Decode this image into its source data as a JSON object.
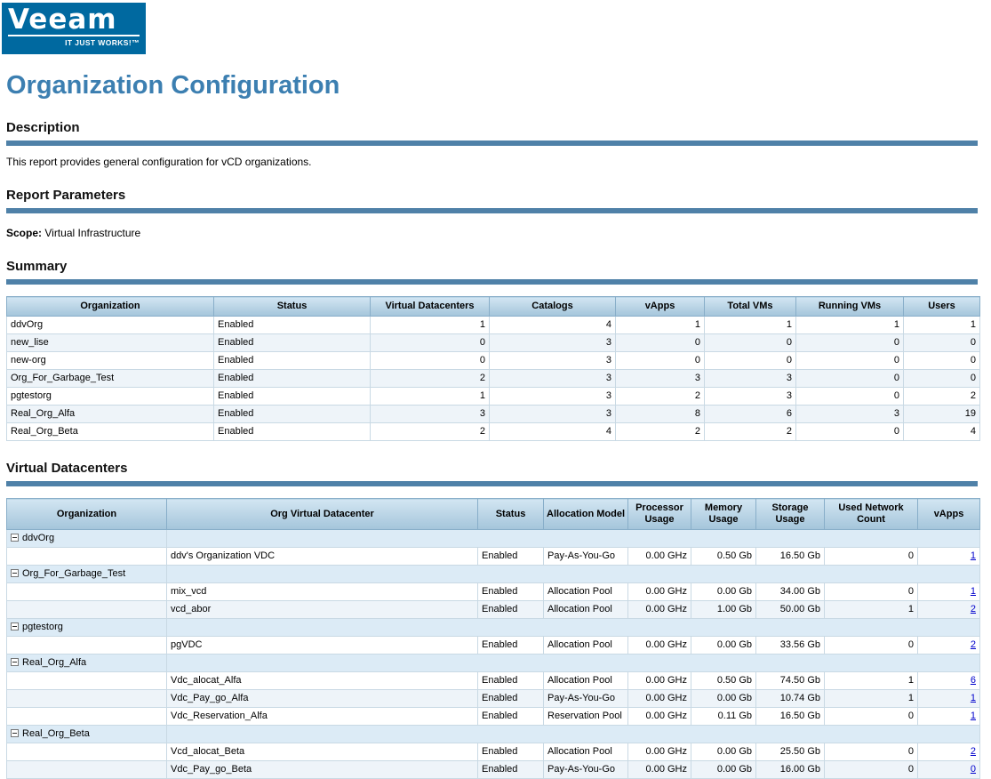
{
  "colors": {
    "brand_blue": "#0069a0",
    "accent_bar": "#4f81a8",
    "title_blue": "#3c7fb1",
    "table_header_bg": "#aed1e8",
    "link_blue": "#0000cc"
  },
  "logo": {
    "brand": "Veeam",
    "tagline": "IT JUST WORKS!™"
  },
  "title": "Organization Configuration",
  "description": {
    "heading": "Description",
    "text": "This report provides general configuration for vCD organizations."
  },
  "parameters": {
    "heading": "Report Parameters",
    "scope_label": "Scope:",
    "scope_value": "Virtual Infrastructure"
  },
  "summary": {
    "heading": "Summary",
    "columns": [
      "Organization",
      "Status",
      "Virtual Datacenters",
      "Catalogs",
      "vApps",
      "Total VMs",
      "Running VMs",
      "Users"
    ],
    "rows": [
      [
        "ddvOrg",
        "Enabled",
        "1",
        "4",
        "1",
        "1",
        "1",
        "1"
      ],
      [
        "new_lise",
        "Enabled",
        "0",
        "3",
        "0",
        "0",
        "0",
        "0"
      ],
      [
        "new-org",
        "Enabled",
        "0",
        "3",
        "0",
        "0",
        "0",
        "0"
      ],
      [
        "Org_For_Garbage_Test",
        "Enabled",
        "2",
        "3",
        "3",
        "3",
        "0",
        "0"
      ],
      [
        "pgtestorg",
        "Enabled",
        "1",
        "3",
        "2",
        "3",
        "0",
        "2"
      ],
      [
        "Real_Org_Alfa",
        "Enabled",
        "3",
        "3",
        "8",
        "6",
        "3",
        "19"
      ],
      [
        "Real_Org_Beta",
        "Enabled",
        "2",
        "4",
        "2",
        "2",
        "0",
        "4"
      ]
    ]
  },
  "virtual_datacenters": {
    "heading": "Virtual Datacenters",
    "columns": [
      "Organization",
      "Org Virtual Datacenter",
      "Status",
      "Allocation Model",
      "Processor Usage",
      "Memory Usage",
      "Storage Usage",
      "Used Network Count",
      "vApps"
    ],
    "groups": [
      {
        "organization": "ddvOrg",
        "rows": [
          {
            "vdc": "ddv's Organization VDC",
            "status": "Enabled",
            "allocation_model": "Pay-As-You-Go",
            "processor_usage": "0.00 GHz",
            "memory_usage": "0.50 Gb",
            "storage_usage": "16.50 Gb",
            "used_network_count": "0",
            "vapps": "1"
          }
        ]
      },
      {
        "organization": "Org_For_Garbage_Test",
        "rows": [
          {
            "vdc": "mix_vcd",
            "status": "Enabled",
            "allocation_model": "Allocation Pool",
            "processor_usage": "0.00 GHz",
            "memory_usage": "0.00 Gb",
            "storage_usage": "34.00 Gb",
            "used_network_count": "0",
            "vapps": "1"
          },
          {
            "vdc": "vcd_abor",
            "status": "Enabled",
            "allocation_model": "Allocation Pool",
            "processor_usage": "0.00 GHz",
            "memory_usage": "1.00 Gb",
            "storage_usage": "50.00 Gb",
            "used_network_count": "1",
            "vapps": "2"
          }
        ]
      },
      {
        "organization": "pgtestorg",
        "rows": [
          {
            "vdc": "pgVDC",
            "status": "Enabled",
            "allocation_model": "Allocation Pool",
            "processor_usage": "0.00 GHz",
            "memory_usage": "0.00 Gb",
            "storage_usage": "33.56 Gb",
            "used_network_count": "0",
            "vapps": "2"
          }
        ]
      },
      {
        "organization": "Real_Org_Alfa",
        "rows": [
          {
            "vdc": "Vdc_alocat_Alfa",
            "status": "Enabled",
            "allocation_model": "Allocation Pool",
            "processor_usage": "0.00 GHz",
            "memory_usage": "0.50 Gb",
            "storage_usage": "74.50 Gb",
            "used_network_count": "1",
            "vapps": "6"
          },
          {
            "vdc": "Vdc_Pay_go_Alfa",
            "status": "Enabled",
            "allocation_model": "Pay-As-You-Go",
            "processor_usage": "0.00 GHz",
            "memory_usage": "0.00 Gb",
            "storage_usage": "10.74 Gb",
            "used_network_count": "1",
            "vapps": "1"
          },
          {
            "vdc": "Vdc_Reservation_Alfa",
            "status": "Enabled",
            "allocation_model": "Reservation Pool",
            "processor_usage": "0.00 GHz",
            "memory_usage": "0.11 Gb",
            "storage_usage": "16.50 Gb",
            "used_network_count": "0",
            "vapps": "1"
          }
        ]
      },
      {
        "organization": "Real_Org_Beta",
        "rows": [
          {
            "vdc": "Vcd_alocat_Beta",
            "status": "Enabled",
            "allocation_model": "Allocation Pool",
            "processor_usage": "0.00 GHz",
            "memory_usage": "0.00 Gb",
            "storage_usage": "25.50 Gb",
            "used_network_count": "0",
            "vapps": "2"
          },
          {
            "vdc": "Vdc_Pay_go_Beta",
            "status": "Enabled",
            "allocation_model": "Pay-As-You-Go",
            "processor_usage": "0.00 GHz",
            "memory_usage": "0.00 Gb",
            "storage_usage": "16.00 Gb",
            "used_network_count": "0",
            "vapps": "0"
          }
        ]
      }
    ]
  }
}
